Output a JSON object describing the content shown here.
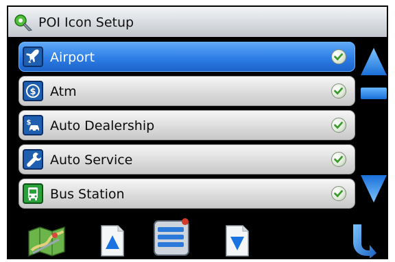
{
  "title": "POI Icon Setup",
  "items": [
    {
      "label": "Airport",
      "icon": "airplane-icon",
      "selected": true,
      "checked": true
    },
    {
      "label": "Atm",
      "icon": "dollar-icon",
      "selected": false,
      "checked": true
    },
    {
      "label": "Auto Dealership",
      "icon": "car-dealer-icon",
      "selected": false,
      "checked": true
    },
    {
      "label": "Auto Service",
      "icon": "wrench-icon",
      "selected": false,
      "checked": true
    },
    {
      "label": "Bus Station",
      "icon": "bus-icon",
      "selected": false,
      "checked": true
    }
  ],
  "colors": {
    "accent": "#2d7de6",
    "frame": "#000000"
  }
}
